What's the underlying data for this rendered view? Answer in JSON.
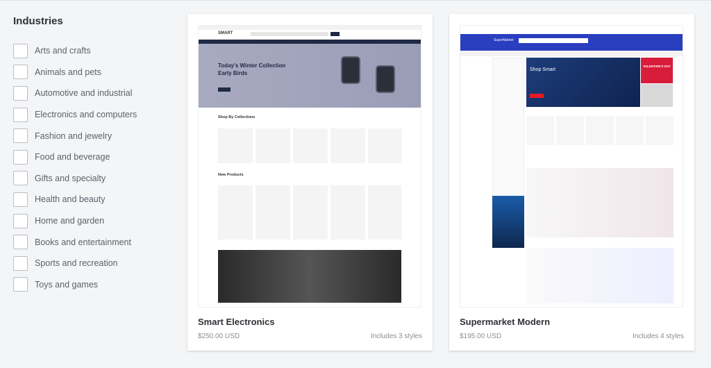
{
  "sidebar": {
    "heading": "Industries",
    "filters": [
      {
        "label": "Arts and crafts",
        "checked": false
      },
      {
        "label": "Animals and pets",
        "checked": false
      },
      {
        "label": "Automotive and industrial",
        "checked": false
      },
      {
        "label": "Electronics and computers",
        "checked": false
      },
      {
        "label": "Fashion and jewelry",
        "checked": false
      },
      {
        "label": "Food and beverage",
        "checked": false
      },
      {
        "label": "Gifts and specialty",
        "checked": false
      },
      {
        "label": "Health and beauty",
        "checked": false
      },
      {
        "label": "Home and garden",
        "checked": false
      },
      {
        "label": "Books and entertainment",
        "checked": false
      },
      {
        "label": "Sports and recreation",
        "checked": false
      },
      {
        "label": "Toys and games",
        "checked": false
      }
    ]
  },
  "themes": [
    {
      "name": "Smart Electronics",
      "price": "$250.00 USD",
      "styles": "Includes 3 styles",
      "preview": {
        "logo": "SMART",
        "hero_title": "Today's Winter Collection Early Birds",
        "section1": "Shop By Collections",
        "section2": "New Products",
        "accent": "#1f2a44"
      }
    },
    {
      "name": "Supermarket Modern",
      "price": "$195.00 USD",
      "styles": "Includes 4 styles",
      "preview": {
        "logo": "SuperMarket",
        "hero_title": "Shop Smart",
        "promo": "VALENTINE'S DAY",
        "accent": "#2a3fbf"
      }
    }
  ]
}
